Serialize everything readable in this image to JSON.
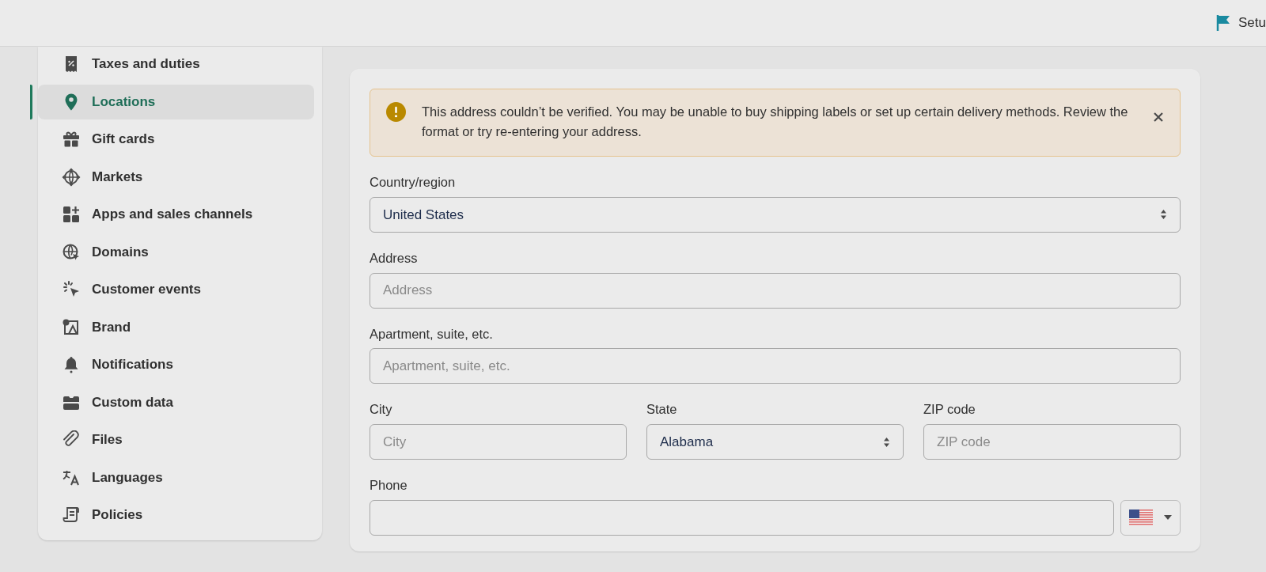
{
  "topbar": {
    "setup_label": "Setu"
  },
  "sidebar": {
    "items": [
      {
        "label": "Taxes and duties",
        "selected": false
      },
      {
        "label": "Locations",
        "selected": true
      },
      {
        "label": "Gift cards",
        "selected": false
      },
      {
        "label": "Markets",
        "selected": false
      },
      {
        "label": "Apps and sales channels",
        "selected": false
      },
      {
        "label": "Domains",
        "selected": false
      },
      {
        "label": "Customer events",
        "selected": false
      },
      {
        "label": "Brand",
        "selected": false
      },
      {
        "label": "Notifications",
        "selected": false
      },
      {
        "label": "Custom data",
        "selected": false
      },
      {
        "label": "Files",
        "selected": false
      },
      {
        "label": "Languages",
        "selected": false
      },
      {
        "label": "Policies",
        "selected": false
      }
    ]
  },
  "banner": {
    "message": "This address couldn’t be verified. You may be unable to buy shipping labels or set up certain delivery methods. Review the format or try re-entering your address."
  },
  "form": [
    {
      "kind": "select",
      "label": "Country/region",
      "value": "United States"
    },
    {
      "kind": "text",
      "label": "Address",
      "placeholder": "Address"
    },
    {
      "kind": "text",
      "label": "Apartment, suite, etc.",
      "placeholder": "Apartment, suite, etc."
    },
    {
      "kind": "row",
      "fields": [
        {
          "kind": "text",
          "label": "City",
          "placeholder": "City"
        },
        {
          "kind": "select",
          "label": "State",
          "value": "Alabama"
        },
        {
          "kind": "text",
          "label": "ZIP code",
          "placeholder": "ZIP code"
        }
      ]
    },
    {
      "kind": "phone",
      "label": "Phone"
    }
  ]
}
